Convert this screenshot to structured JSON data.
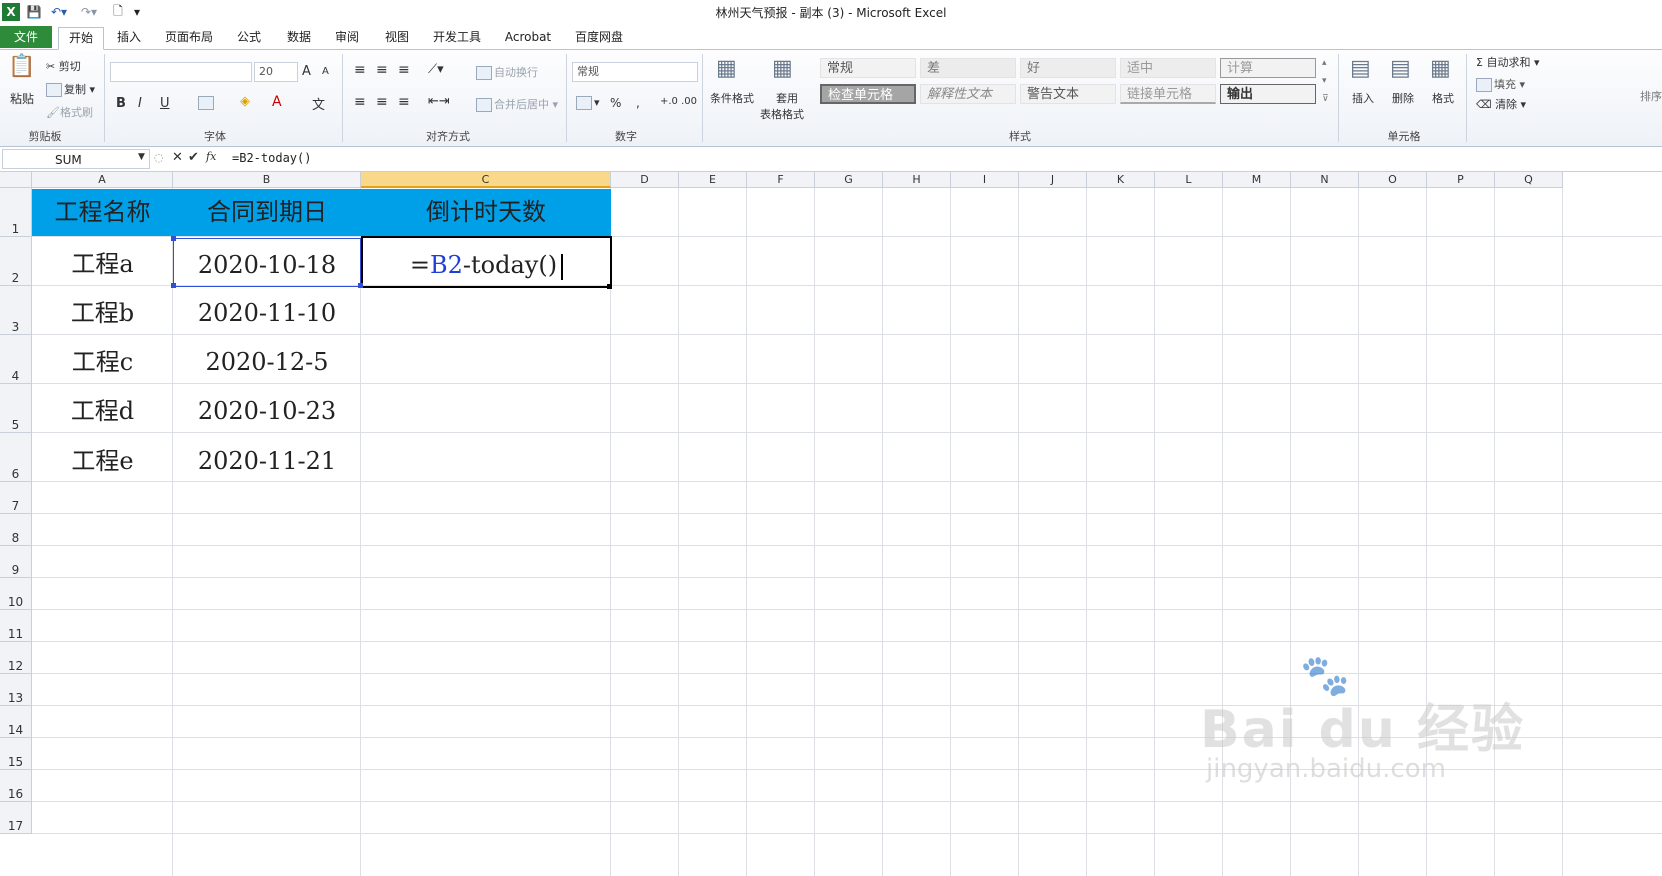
{
  "window": {
    "title": "林州天气预报 - 副本 (3)  -  Microsoft Excel"
  },
  "tabs": [
    "文件",
    "开始",
    "插入",
    "页面布局",
    "公式",
    "数据",
    "审阅",
    "视图",
    "开发工具",
    "Acrobat",
    "百度网盘"
  ],
  "ribbon": {
    "clipboard": {
      "paste": "粘贴",
      "cut": "剪切",
      "copy": "复制 ▾",
      "format_painter": "格式刷",
      "label": "剪贴板"
    },
    "font": {
      "font_size": "20",
      "grow": "A",
      "shrink": "A",
      "bold": "B",
      "italic": "I",
      "underline": "U",
      "font_color": "A",
      "label": "字体"
    },
    "alignment": {
      "wrap": "自动换行",
      "merge": "合并后居中 ▾",
      "label": "对齐方式"
    },
    "number": {
      "format": "常规",
      "percent": "%",
      "comma": ",",
      "inc_dec": "+.0 .00",
      "label": "数字"
    },
    "styles": {
      "conditional": "条件格式",
      "table_format_1": "套用",
      "table_format_2": "表格格式",
      "cells": [
        "常规",
        "差",
        "好",
        "适中",
        "计算",
        "检查单元格",
        "解释性文本",
        "警告文本",
        "链接单元格",
        "输出"
      ],
      "label": "样式"
    },
    "cells_group": {
      "insert": "插入",
      "delete": "删除",
      "format": "格式",
      "label": "单元格"
    },
    "editing": {
      "autosum": "Σ 自动求和 ▾",
      "fill": "填充 ▾",
      "clear": "清除 ▾",
      "sort": "排序"
    }
  },
  "formula_bar": {
    "name_box": "SUM",
    "fx": "fx",
    "formula": "=B2-today()"
  },
  "columns": [
    "A",
    "B",
    "C",
    "D",
    "E",
    "F",
    "G",
    "H",
    "I",
    "J",
    "K",
    "L",
    "M",
    "N",
    "O",
    "P",
    "Q"
  ],
  "rows": [
    "1",
    "2",
    "3",
    "4",
    "5",
    "6",
    "7",
    "8",
    "9",
    "10",
    "11",
    "12",
    "13",
    "14",
    "15",
    "16",
    "17"
  ],
  "table": {
    "headers": [
      "工程名称",
      "合同到期日",
      "倒计时天数"
    ],
    "rows": [
      [
        "工程a",
        "2020-10-18"
      ],
      [
        "工程b",
        "2020-11-10"
      ],
      [
        "工程c",
        "2020-12-5"
      ],
      [
        "工程d",
        "2020-10-23"
      ],
      [
        "工程e",
        "2020-11-21"
      ]
    ],
    "editing_cell": {
      "prefix": "=",
      "ref": "B2",
      "suffix": "-today()"
    }
  },
  "watermark": {
    "brand": "Bai du 经验",
    "url": "jingyan.baidu.com"
  },
  "colors": {
    "header_fill": "#00a0e9",
    "file_tab": "#2e8b3a",
    "ref_blue": "#1f3fd6"
  }
}
